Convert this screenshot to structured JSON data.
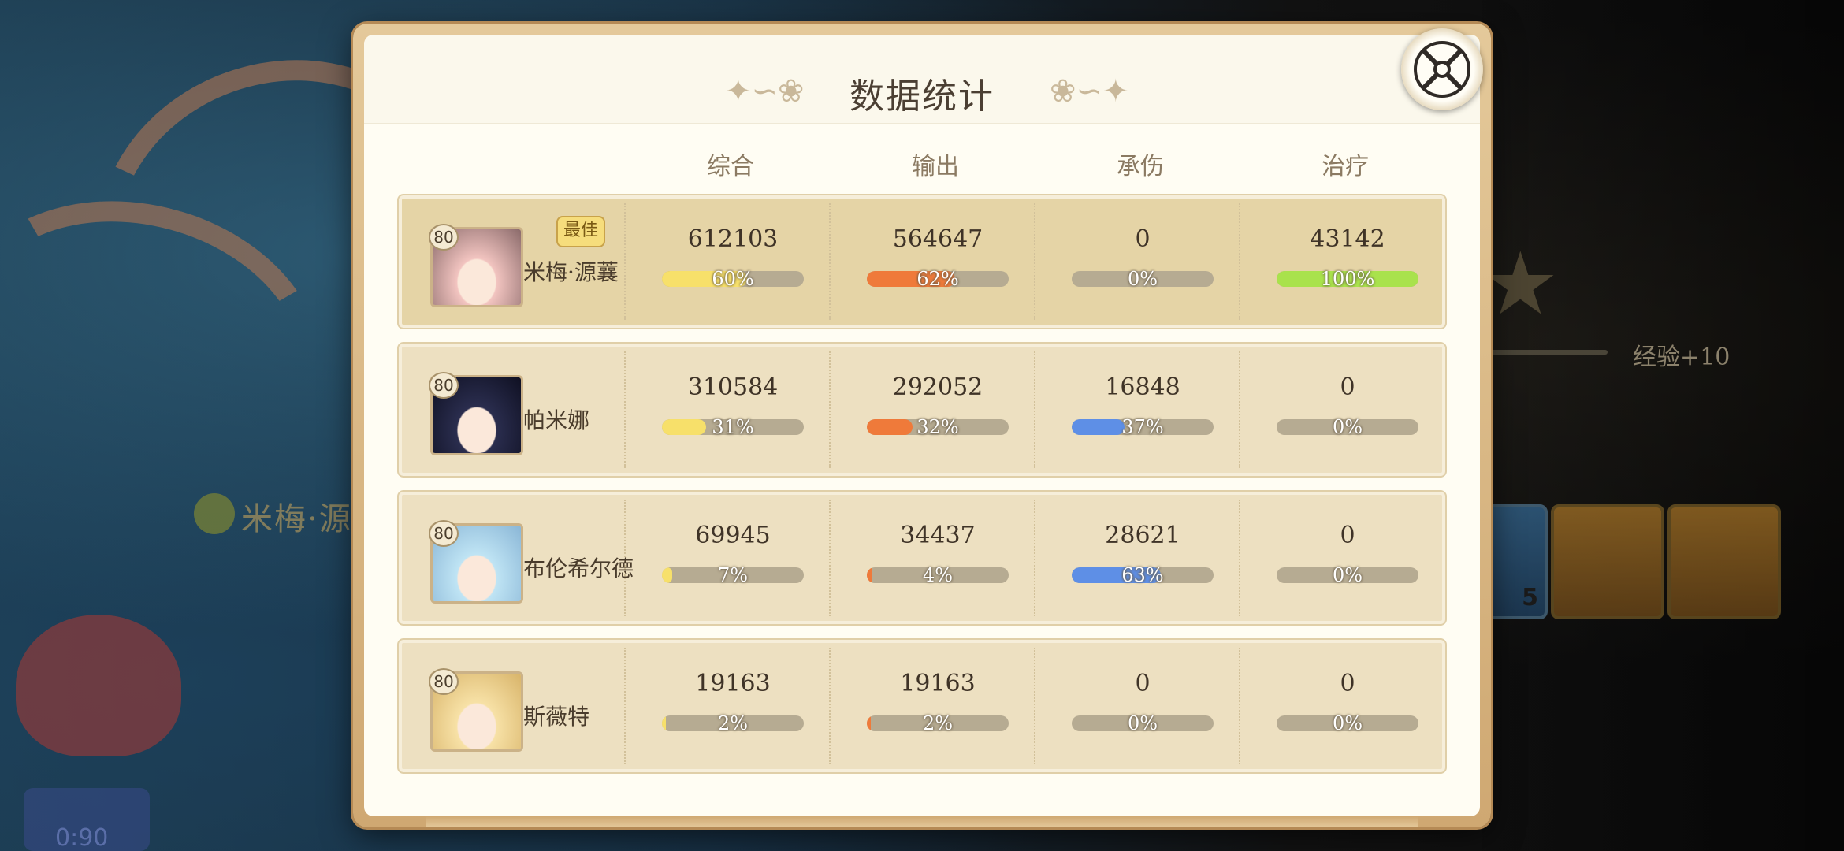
{
  "dialog": {
    "title": "数据统计",
    "close_icon": "close-icon",
    "columns": [
      "综合",
      "输出",
      "承伤",
      "治疗"
    ]
  },
  "colors": {
    "综合": "#f7e06a",
    "输出": "#ef7a3a",
    "承伤": "#5e8fe6",
    "治疗": "#a9e24c"
  },
  "players": [
    {
      "level": "80",
      "name": "米梅·源蘘",
      "best": "最佳",
      "stats": [
        {
          "value": "612103",
          "percent": 60,
          "label": "60%"
        },
        {
          "value": "564647",
          "percent": 62,
          "label": "62%"
        },
        {
          "value": "0",
          "percent": 0,
          "label": "0%"
        },
        {
          "value": "43142",
          "percent": 100,
          "label": "100%"
        }
      ]
    },
    {
      "level": "80",
      "name": "帕米娜",
      "best": "",
      "stats": [
        {
          "value": "310584",
          "percent": 31,
          "label": "31%"
        },
        {
          "value": "292052",
          "percent": 32,
          "label": "32%"
        },
        {
          "value": "16848",
          "percent": 37,
          "label": "37%"
        },
        {
          "value": "0",
          "percent": 0,
          "label": "0%"
        }
      ]
    },
    {
      "level": "80",
      "name": "布伦希尔德",
      "best": "",
      "stats": [
        {
          "value": "69945",
          "percent": 7,
          "label": "7%"
        },
        {
          "value": "34437",
          "percent": 4,
          "label": "4%"
        },
        {
          "value": "28621",
          "percent": 63,
          "label": "63%"
        },
        {
          "value": "0",
          "percent": 0,
          "label": "0%"
        }
      ]
    },
    {
      "level": "80",
      "name": "斯薇特",
      "best": "",
      "stats": [
        {
          "value": "19163",
          "percent": 2,
          "label": "2%"
        },
        {
          "value": "19163",
          "percent": 2,
          "label": "2%"
        },
        {
          "value": "0",
          "percent": 0,
          "label": "0%"
        },
        {
          "value": "0",
          "percent": 0,
          "label": "0%"
        }
      ]
    }
  ],
  "background": {
    "character_name": "米梅·源蘘",
    "exp_text": "经验+10",
    "item_count": "5",
    "timer": "0:90"
  }
}
